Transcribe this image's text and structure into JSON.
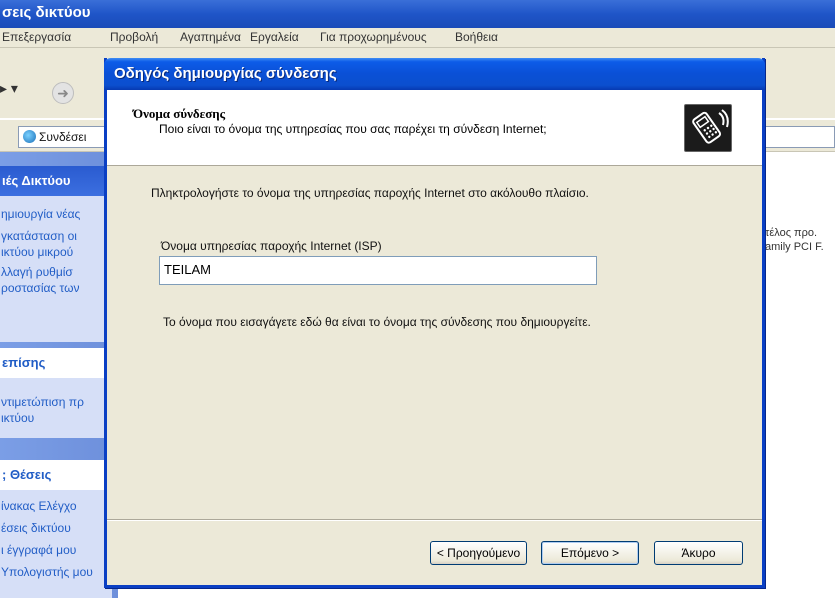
{
  "background_window": {
    "title": "σεις δικτύου",
    "menu": [
      "Επεξεργασία",
      "Προβολή",
      "Αγαπημένα",
      "Εργαλεία",
      "Για προχωρημένους",
      "Βοήθεια"
    ],
    "address_text": "Συνδέσει",
    "task_groups": [
      {
        "header": "ιές Δικτύου",
        "links": [
          "ημιουργία νέας",
          "γκατάσταση οι",
          "ικτύου μικρού",
          "λλαγή ρυθμίσ",
          "ροστασίας των"
        ]
      },
      {
        "header": "επίσης",
        "links": [
          "ντιμετώπιση πρ",
          "ικτύου"
        ]
      },
      {
        "header": "; Θέσεις",
        "links": [
          "ίνακας Ελέγχο",
          "έσεις δικτύου",
          "ι έγγραφά μου",
          "Υπολογιστής μου"
        ]
      }
    ],
    "right_text": [
      "τέλος προ.",
      "amily PCI F."
    ]
  },
  "dialog": {
    "title": "Οδηγός δημιουργίας σύνδεσης",
    "header_title": "Όνομα σύνδεσης",
    "header_subtitle": "Ποιο είναι το όνομα της υπηρεσίας που σας παρέχει τη σύνδεση Internet;",
    "header_icon": "phone-connection-icon",
    "instruction": "Πληκτρολογήστε το όνομα της υπηρεσίας παροχής Internet στο ακόλουθο πλαίσιο.",
    "field_label": "Όνομα υπηρεσίας παροχής Internet (ISP)",
    "isp_value": "TEILAM",
    "note": "Το όνομα που εισαγάγετε εδώ θα είναι το όνομα της σύνδεσης που δημιουργείτε.",
    "buttons": {
      "back": "< Προηγούμενο",
      "next": "Επόμενο >",
      "cancel": "Άκυρο"
    }
  },
  "colors": {
    "titlebar": "#0a50d6",
    "dialog_bg": "#ece9d8",
    "link": "#215dc6",
    "task_pane": "#6d8fdb"
  }
}
